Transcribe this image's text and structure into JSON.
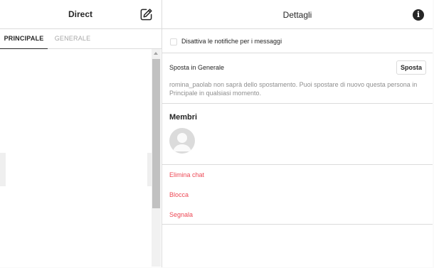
{
  "left": {
    "title": "Direct",
    "compose_icon": "edit-square-icon",
    "tabs": [
      {
        "label": "PRINCIPALE",
        "active": true
      },
      {
        "label": "GENERALE",
        "active": false
      }
    ]
  },
  "right": {
    "title": "Dettagli",
    "info_icon": "info-icon",
    "info_glyph": "i",
    "mute": {
      "label": "Disattiva le notifiche per i messaggi",
      "checked": false
    },
    "move": {
      "title": "Sposta in Generale",
      "button_label": "Sposta",
      "description": "romina_paolab non saprà dello spostamento. Puoi spostare di nuovo questa persona in Principale in qualsiasi momento."
    },
    "members": {
      "title": "Membri"
    },
    "actions": [
      {
        "label": "Elimina chat"
      },
      {
        "label": "Blocca"
      },
      {
        "label": "Segnala"
      }
    ]
  },
  "colors": {
    "danger": "#ed4956",
    "border": "#dbdbdb",
    "text": "#262626",
    "muted": "#8e8e8e"
  }
}
